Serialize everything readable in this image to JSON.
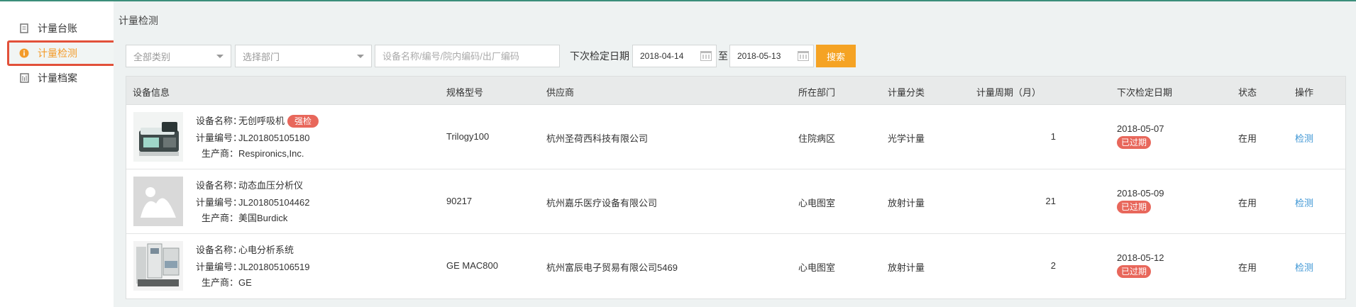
{
  "sidebar": {
    "items": [
      {
        "label": "计量台账",
        "icon": "ledger-icon",
        "active": false
      },
      {
        "label": "计量检测",
        "icon": "info-circle-icon",
        "active": true
      },
      {
        "label": "计量档案",
        "icon": "archive-icon",
        "active": false
      }
    ]
  },
  "breadcrumb": "计量检测",
  "filters": {
    "category": "全部类别",
    "department": "选择部门",
    "search_placeholder": "设备名称/编号/院内编码/出厂编码",
    "date_label": "下次检定日期",
    "date_from": "2018-04-14",
    "to_label": "至",
    "date_to": "2018-05-13",
    "search_button": "搜索"
  },
  "table": {
    "headers": [
      "设备信息",
      "规格型号",
      "供应商",
      "所在部门",
      "计量分类",
      "计量周期（月）",
      "下次检定日期",
      "状态",
      "操作"
    ],
    "info_keys": {
      "name": "设备名称：",
      "code": "计量编号：",
      "maker": "生产商："
    },
    "rows": [
      {
        "name": "无创呼吸机",
        "tag": "强检",
        "code": "JL201805105180",
        "maker": "Respironics,Inc.",
        "model": "Trilogy100",
        "supplier": "杭州圣荷西科技有限公司",
        "dept": "住院病区",
        "category": "光学计量",
        "cycle": "1",
        "next_date": "2018-05-07",
        "expired": "已过期",
        "status": "在用",
        "action": "检测",
        "thumb": "ventilator-image"
      },
      {
        "name": "动态血压分析仪",
        "tag": "",
        "code": "JL201805104462",
        "maker": "美国Burdick",
        "model": "90217",
        "supplier": "杭州嘉乐医疗设备有限公司",
        "dept": "心电图室",
        "category": "放射计量",
        "cycle": "21",
        "next_date": "2018-05-09",
        "expired": "已过期",
        "status": "在用",
        "action": "检测",
        "thumb": "placeholder-image"
      },
      {
        "name": "心电分析系统",
        "tag": "",
        "code": "JL201805106519",
        "maker": "GE",
        "model": "GE MAC800",
        "supplier": "杭州富辰电子贸易有限公司5469",
        "dept": "心电图室",
        "category": "放射计量",
        "cycle": "2",
        "next_date": "2018-05-12",
        "expired": "已过期",
        "status": "在用",
        "action": "检测",
        "thumb": "ecg-system-image"
      }
    ]
  },
  "colors": {
    "accent": "#f5a324",
    "active_text": "#f39b2a",
    "highlight_border": "#e2513a",
    "tag_red": "#e8675b",
    "link": "#3c95d4"
  }
}
